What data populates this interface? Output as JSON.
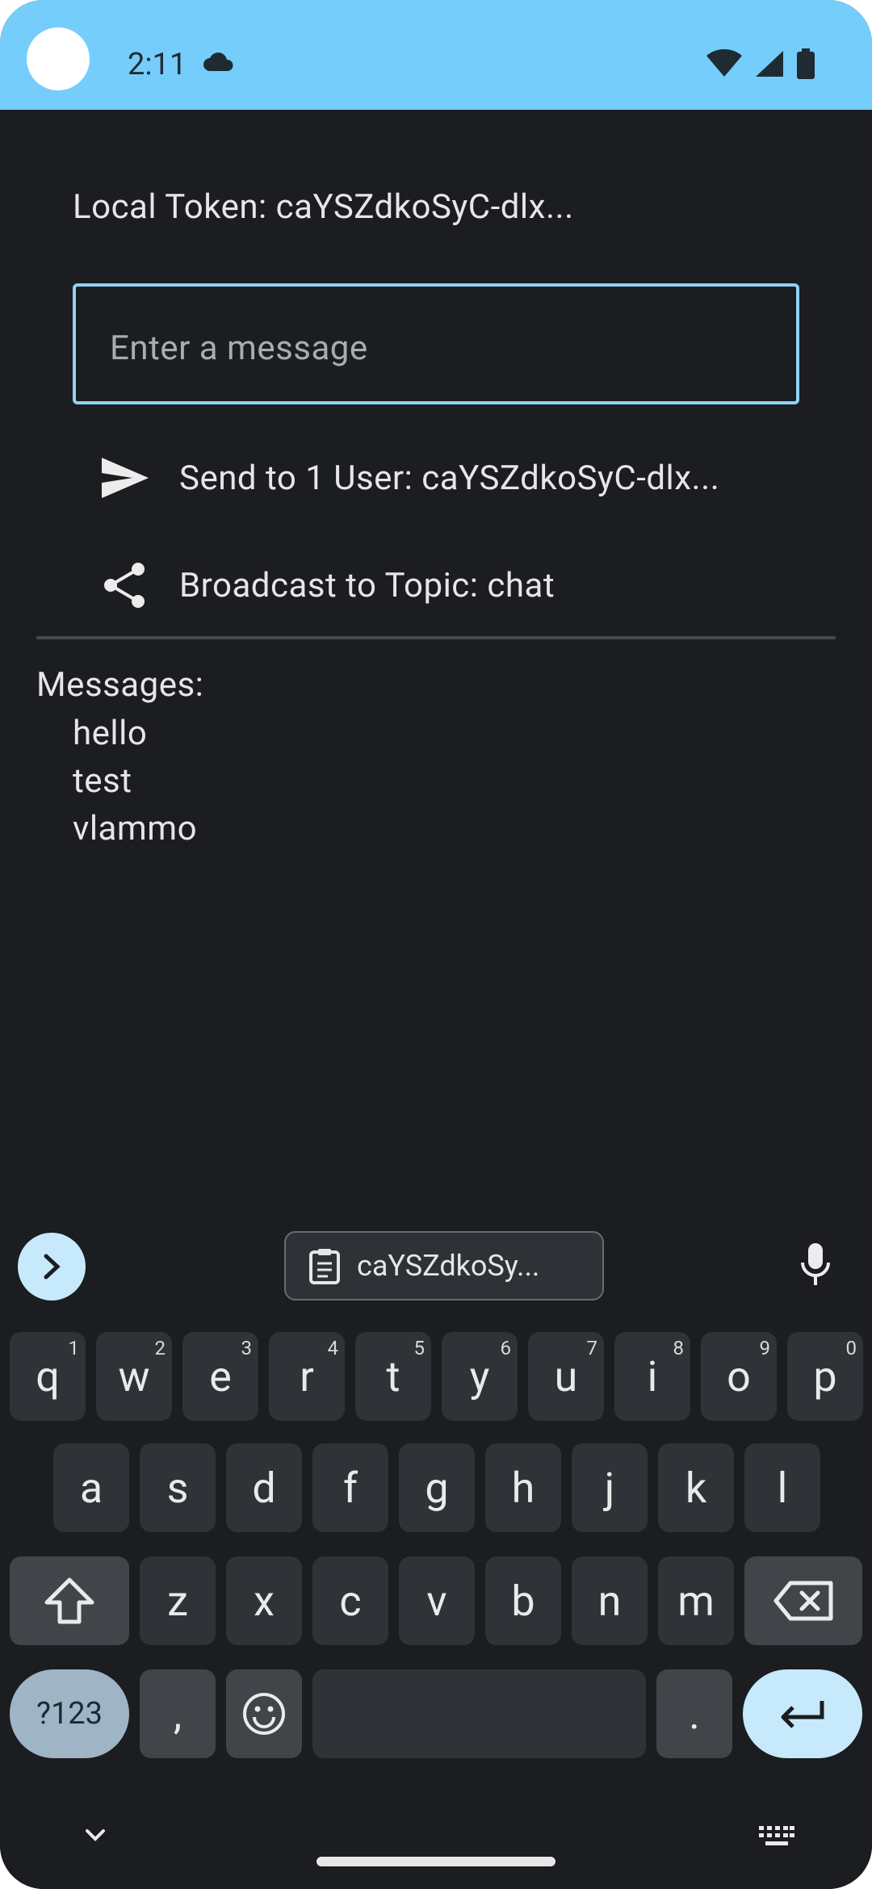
{
  "status": {
    "time": "2:11"
  },
  "app": {
    "local_token": "Local Token: caYSZdkoSyC-dlx...",
    "message_placeholder": "Enter a message",
    "send_label": "Send to 1 User: caYSZdkoSyC-dlx...",
    "broadcast_label": "Broadcast to Topic: chat",
    "messages_title": "Messages:",
    "messages": [
      "hello",
      "test",
      "vlammo"
    ]
  },
  "keyboard": {
    "clipboard": "caYSZdkoSy...",
    "row1": [
      {
        "k": "q",
        "n": "1"
      },
      {
        "k": "w",
        "n": "2"
      },
      {
        "k": "e",
        "n": "3"
      },
      {
        "k": "r",
        "n": "4"
      },
      {
        "k": "t",
        "n": "5"
      },
      {
        "k": "y",
        "n": "6"
      },
      {
        "k": "u",
        "n": "7"
      },
      {
        "k": "i",
        "n": "8"
      },
      {
        "k": "o",
        "n": "9"
      },
      {
        "k": "p",
        "n": "0"
      }
    ],
    "row2": [
      "a",
      "s",
      "d",
      "f",
      "g",
      "h",
      "j",
      "k",
      "l"
    ],
    "row3": [
      "z",
      "x",
      "c",
      "v",
      "b",
      "n",
      "m"
    ],
    "symbols_label": "?123",
    "comma": ",",
    "period": "."
  },
  "colors": {
    "statusbar": "#75cdfc",
    "focus_border": "#8fd2f6",
    "background": "#1b1d20"
  }
}
